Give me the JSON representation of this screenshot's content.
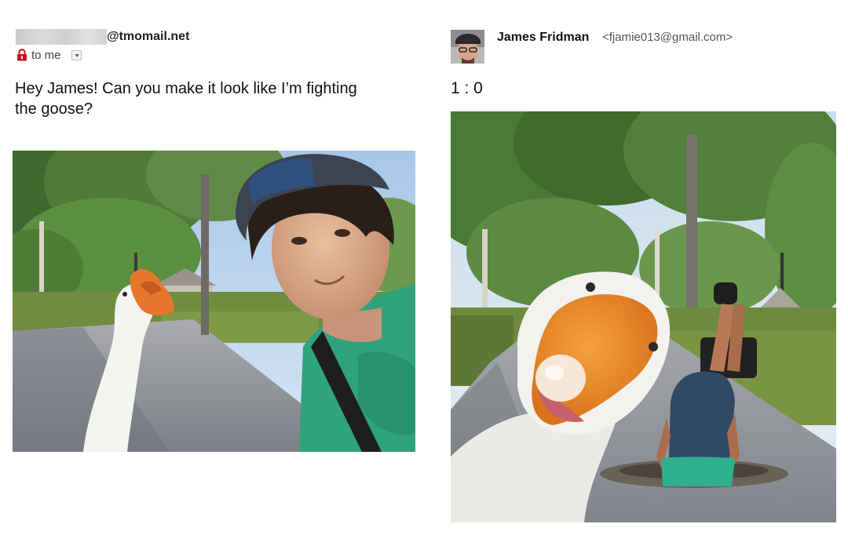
{
  "left_email": {
    "sender_domain": "@tmomail.net",
    "recipient_label": "to me",
    "message": "Hey James! Can you make it look like I’m fighting the goose?",
    "icons": {
      "lock": "lock-icon",
      "dropdown": "chevron-down-icon"
    }
  },
  "right_email": {
    "sender_name": "James Fridman",
    "sender_email": "<fjamie013@gmail.com>",
    "reply": "1 : 0"
  },
  "colors": {
    "lock_red": "#c4161c",
    "foliage": "#4f7a3a",
    "goose_beak": "#e8772e",
    "shirt_teal": "#2fa37a",
    "path_grey": "#8b8e95"
  }
}
